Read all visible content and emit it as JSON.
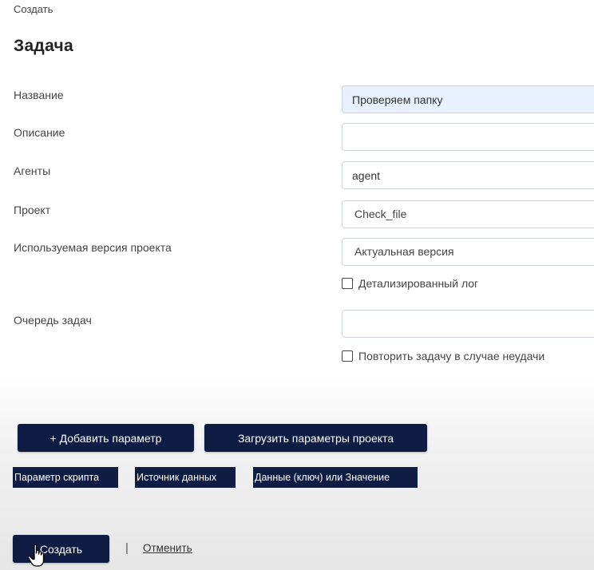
{
  "breadcrumb": "Создать",
  "page_title": "Задача",
  "form": {
    "name_label": "Название",
    "name_value": "Проверяем папку",
    "description_label": "Описание",
    "description_value": "",
    "agents_label": "Агенты",
    "agents_value": "agent",
    "project_label": "Проект",
    "project_value": "Check_file",
    "version_label": "Используемая версия проекта",
    "version_value": "Актуальная версия",
    "detailed_log_label": "Детализированный лог",
    "detailed_log_checked": false,
    "queue_label": "Очередь задач",
    "queue_value": "",
    "retry_label": "Повторить задачу в случае неудачи",
    "retry_checked": false
  },
  "params": {
    "add_param_button": "+ Добавить параметр",
    "load_params_button": "Загрузить параметры проекта",
    "headers": [
      "Параметр скрипта",
      "Источник данных",
      "Данные (ключ) или Значение"
    ]
  },
  "actions": {
    "create_button": "Создать",
    "separator": "|",
    "cancel_link": "Отменить"
  },
  "colors": {
    "button_bg": "#0f1d44",
    "filled_field_bg": "#e8f0fe"
  },
  "icons": {
    "cursor": "hand-pointer-icon"
  }
}
